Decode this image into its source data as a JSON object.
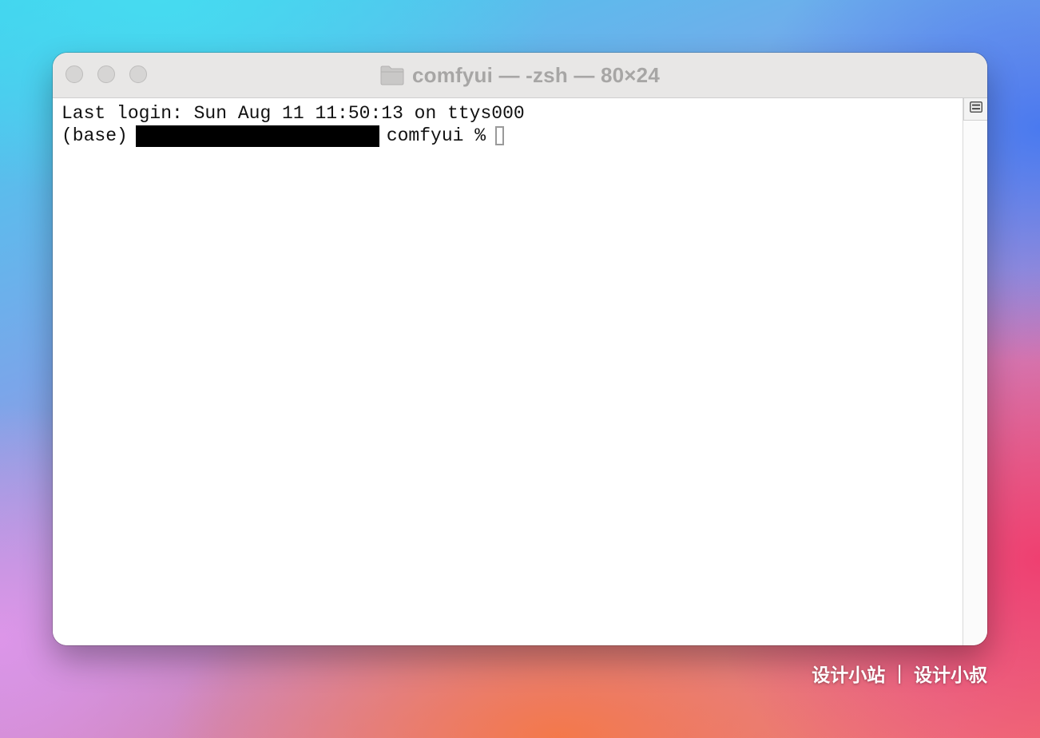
{
  "window": {
    "title": "comfyui — -zsh — 80×24",
    "folder_icon": "folder-icon"
  },
  "terminal": {
    "line1": "Last login: Sun Aug 11 11:50:13 on ttys000",
    "prompt_prefix": "(base)",
    "prompt_suffix": "comfyui %"
  },
  "watermark": {
    "left": "设计小站",
    "separator": "|",
    "right": "设计小叔"
  },
  "colors": {
    "titlebar": "#e8e7e6",
    "title_text": "#a7a6a5",
    "terminal_bg": "#ffffff",
    "terminal_text": "#111111"
  }
}
